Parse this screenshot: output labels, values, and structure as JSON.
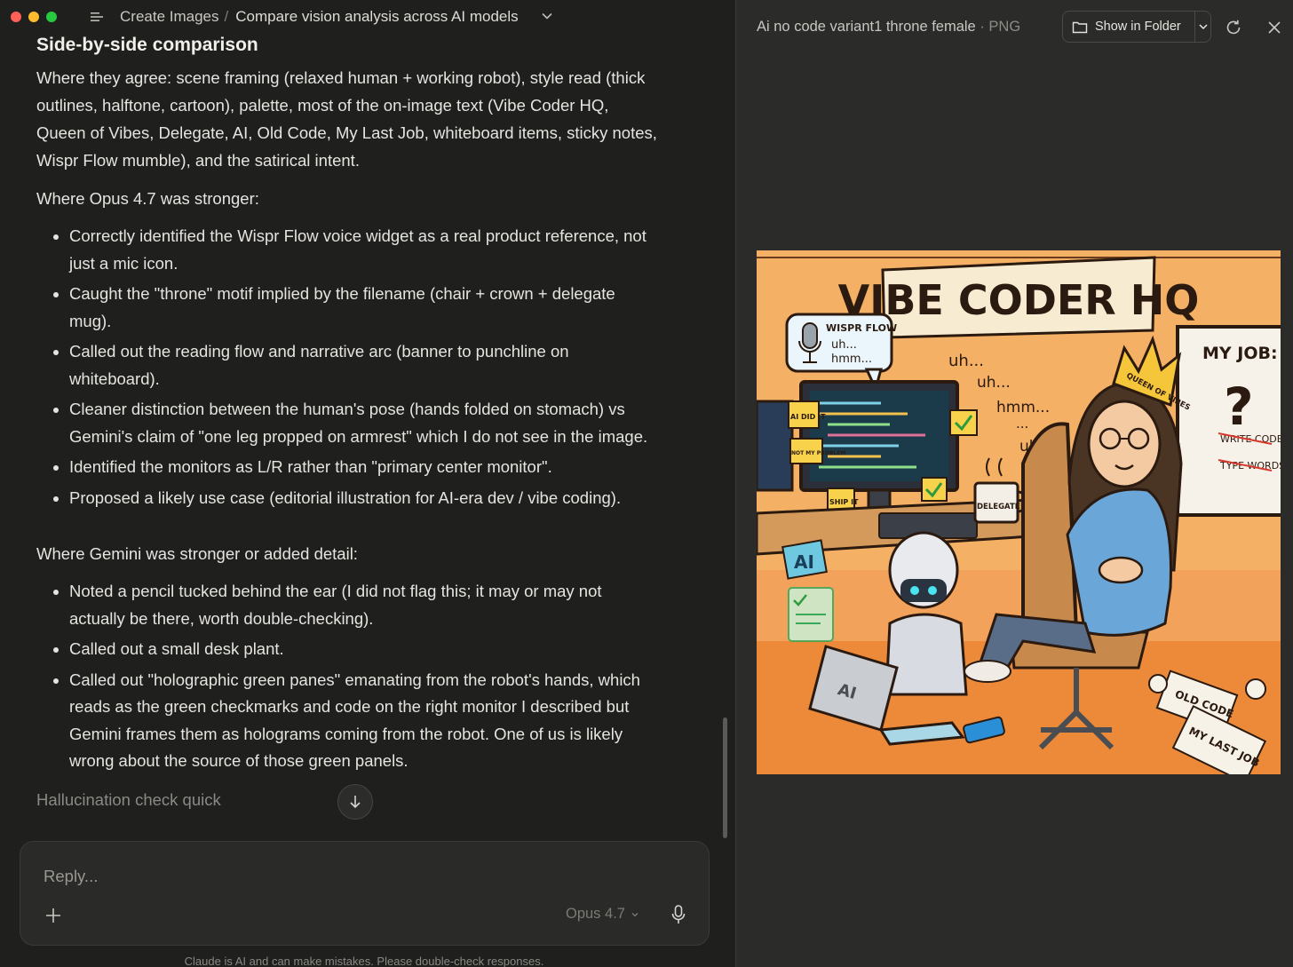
{
  "breadcrumb": {
    "parent": "Create Images",
    "separator": "/",
    "current": "Compare vision analysis across AI models"
  },
  "message": {
    "heading": "Side-by-side comparison",
    "agree": "Where they agree: scene framing (relaxed human + working robot), style read (thick outlines, halftone, cartoon), palette, most of the on-image text (Vibe Coder HQ, Queen of Vibes, Delegate, AI, Old Code, My Last Job, whiteboard items, sticky notes, Wispr Flow mumble), and the satirical intent.",
    "opus_heading": "Where Opus 4.7 was stronger:",
    "opus_points": [
      "Correctly identified the Wispr Flow voice widget as a real product reference, not just a mic icon.",
      "Caught the \"throne\" motif implied by the filename (chair + crown + delegate mug).",
      "Called out the reading flow and narrative arc (banner to punchline on whiteboard).",
      "Cleaner distinction between the human's pose (hands folded on stomach) vs Gemini's claim of \"one leg propped on armrest\" which I do not see in the image.",
      "Identified the monitors as L/R rather than \"primary center monitor\".",
      "Proposed a likely use case (editorial illustration for AI-era dev / vibe coding)."
    ],
    "gemini_heading": "Where Gemini was stronger or added detail:",
    "gemini_points": [
      "Noted a pencil tucked behind the ear (I did not flag this; it may or may not actually be there, worth double-checking).",
      "Called out a small desk plant.",
      "Called out \"holographic green panes\" emanating from the robot's hands, which reads as the green checkmarks and code on the right monitor I described but Gemini frames them as holograms coming from the robot. One of us is likely wrong about the source of those green panels."
    ],
    "trailing": "Hallucination check quick"
  },
  "composer": {
    "placeholder": "Reply...",
    "model": "Opus 4.7"
  },
  "disclaimer": "Claude is AI and can make mistakes. Please double-check responses.",
  "preview": {
    "file_name": "Ai no code variant1 throne female",
    "file_ext": "· PNG",
    "show_in_folder": "Show in Folder"
  },
  "illustration": {
    "banner": "VIBE CODER HQ",
    "bubble_title": "WISPR FLOW",
    "bubble_line1": "uh...",
    "bubble_line2": "hmm...",
    "mumble": [
      "uh...",
      "uh...",
      "hmm...",
      "...",
      "uh..."
    ],
    "crown": "QUEEN OF VIBES",
    "whiteboard_title": "MY JOB:",
    "whiteboard_q": "?",
    "whiteboard_item1": "WRITE CODE",
    "whiteboard_item2": "TYPE WORDS",
    "sticky1": "AI DID IT",
    "sticky2": "NOT MY PROBLEM",
    "sticky3": "SHIP IT",
    "mug": "DELEGATE",
    "laptop": "AI",
    "ai_card": "AI",
    "paper1": "OLD CODE",
    "paper2": "MY LAST JOB"
  },
  "colors": {
    "background": "#1f1f1e",
    "panel": "#2b2b2a",
    "illustration_orange": "#f08a3c",
    "hoodie_blue": "#6aa7d8"
  }
}
